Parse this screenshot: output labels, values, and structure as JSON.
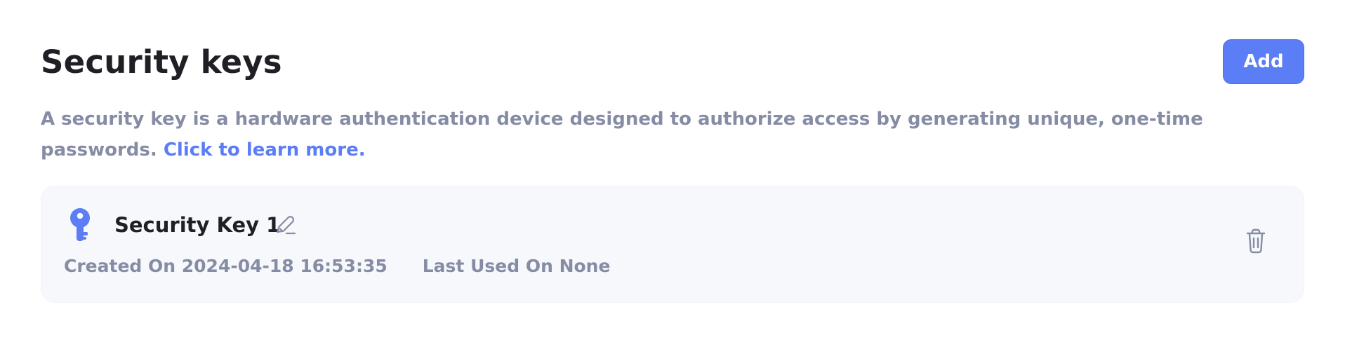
{
  "header": {
    "title": "Security keys",
    "add_label": "Add"
  },
  "description": {
    "text": "A security key is a hardware authentication device designed to authorize access by generating unique, one-time passwords. ",
    "link_label": "Click to learn more."
  },
  "security_key": {
    "name": "Security Key 1",
    "created_on": "Created On 2024-04-18 16:53:35",
    "last_used_on": "Last Used On None",
    "key_icon": "key-icon",
    "edit_icon": "pencil-icon",
    "delete_icon": "trash-icon"
  },
  "colors": {
    "accent": "#5b7df5",
    "muted_text": "#858ca4",
    "title_text": "#1f1f25",
    "card_background": "#f7f8fc"
  }
}
